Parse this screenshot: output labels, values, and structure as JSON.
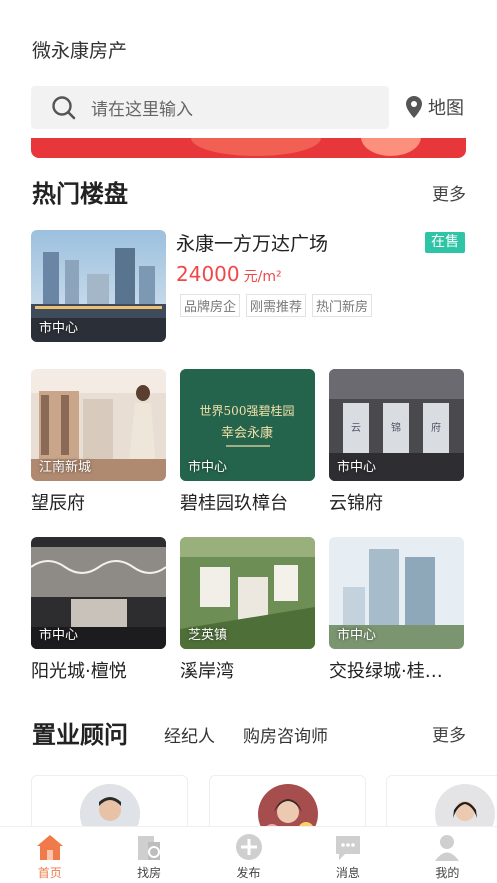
{
  "header": {
    "title": "微永康房产"
  },
  "search": {
    "placeholder": "请在这里输入",
    "map_label": "地图"
  },
  "hot": {
    "title": "热门楼盘",
    "more": "更多",
    "featured": {
      "name": "永康一方万达广场",
      "status": "在售",
      "price": "24000",
      "unit": "元/m²",
      "tags": [
        "品牌房企",
        "刚需推荐",
        "热门新房"
      ],
      "area": "市中心"
    },
    "items": [
      {
        "name": "望辰府",
        "area": "江南新城"
      },
      {
        "name": "碧桂园玖樟台",
        "area": "市中心",
        "banner_line1": "世界500强碧桂园",
        "banner_line2": "幸会永康"
      },
      {
        "name": "云锦府",
        "area": "市中心"
      },
      {
        "name": "阳光城·檀悦",
        "area": "市中心"
      },
      {
        "name": "溪岸湾",
        "area": "芝英镇"
      },
      {
        "name": "交投绿城·桂…",
        "area": "市中心"
      }
    ]
  },
  "advisors": {
    "title": "置业顾问",
    "tabs": [
      "经纪人",
      "购房咨询师"
    ],
    "more": "更多"
  },
  "tabbar": [
    {
      "label": "首页",
      "icon": "home-icon",
      "active": true
    },
    {
      "label": "找房",
      "icon": "find-house-icon",
      "active": false
    },
    {
      "label": "发布",
      "icon": "publish-icon",
      "active": false
    },
    {
      "label": "消息",
      "icon": "message-icon",
      "active": false
    },
    {
      "label": "我的",
      "icon": "profile-icon",
      "active": false
    }
  ],
  "colors": {
    "accent": "#f07a4a",
    "price": "#f04848",
    "sale_badge": "#2ec4a6",
    "banner": "#e8373b"
  }
}
